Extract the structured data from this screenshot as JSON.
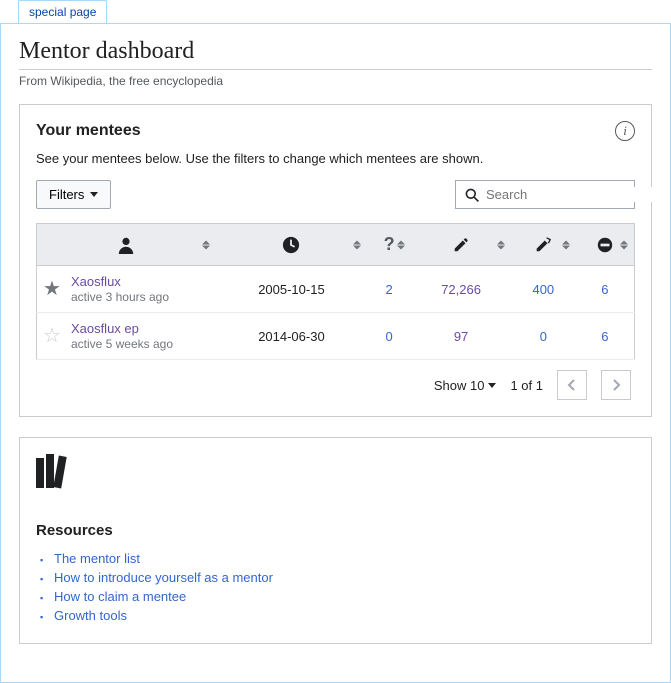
{
  "tab": "special page",
  "title": "Mentor dashboard",
  "subtitle": "From Wikipedia, the free encyclopedia",
  "mentees": {
    "title": "Your mentees",
    "desc": "See your mentees below. Use the filters to change which mentees are shown.",
    "filters_label": "Filters",
    "search_placeholder": "Search",
    "rows": [
      {
        "starred": true,
        "name": "Xaosflux",
        "active": "active 3 hours ago",
        "date": "2005-10-15",
        "questions": "2",
        "edits": "72,266",
        "reverts": "400",
        "blocks": "6"
      },
      {
        "starred": false,
        "name": "Xaosflux ep",
        "active": "active 5 weeks ago",
        "date": "2014-06-30",
        "questions": "0",
        "edits": "97",
        "reverts": "0",
        "blocks": "6"
      }
    ],
    "show_label": "Show 10",
    "page_info": "1 of 1"
  },
  "resources": {
    "title": "Resources",
    "links": [
      "The mentor list",
      "How to introduce yourself as a mentor",
      "How to claim a mentee",
      "Growth tools"
    ]
  }
}
